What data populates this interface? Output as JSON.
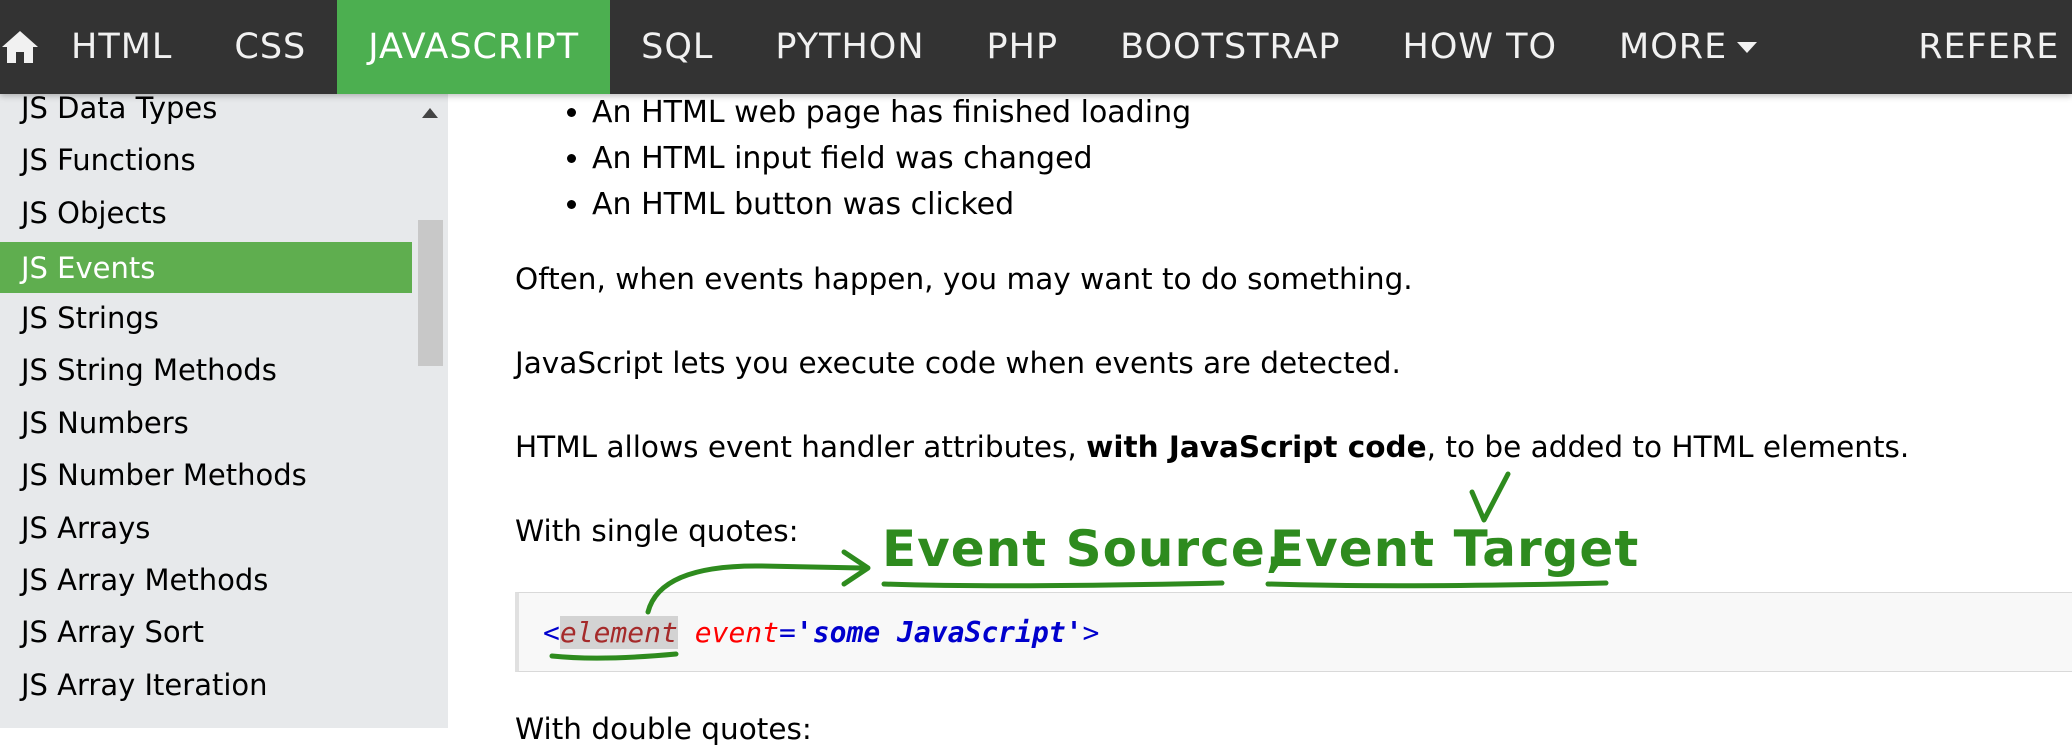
{
  "nav": {
    "items": [
      "HTML",
      "CSS",
      "JAVASCRIPT",
      "SQL",
      "PYTHON",
      "PHP",
      "BOOTSTRAP",
      "HOW TO",
      "MORE",
      "REFERE"
    ],
    "active": "JAVASCRIPT",
    "home_icon": "home-icon",
    "accent": "#4caf50"
  },
  "sidebar": {
    "items": [
      "JS Data Types",
      "JS Functions",
      "JS Objects",
      "JS Events",
      "JS Strings",
      "JS String Methods",
      "JS Numbers",
      "JS Number Methods",
      "JS Arrays",
      "JS Array Methods",
      "JS Array Sort",
      "JS Array Iteration"
    ],
    "active_item": "JS Events"
  },
  "content": {
    "bullets": [
      "An HTML web page has finished loading",
      "An HTML input field was changed",
      "An HTML button was clicked"
    ],
    "p1": "Often, when events happen, you may want to do something.",
    "p2": "JavaScript lets you execute code when events are detected.",
    "p3_before": "HTML allows event handler attributes, ",
    "p3_bold": "with JavaScript code",
    "p3_after": ", to be added to HTML elements.",
    "p4": "With single quotes:",
    "p5": "With double quotes:",
    "code": {
      "lt": "<",
      "tag": "element",
      "attr": "event",
      "eq": "=",
      "value": "'some JavaScript'",
      "gt": ">"
    }
  },
  "annotations": {
    "source": "Event Source,",
    "target": "Event Target",
    "color": "#2e8b1e"
  }
}
